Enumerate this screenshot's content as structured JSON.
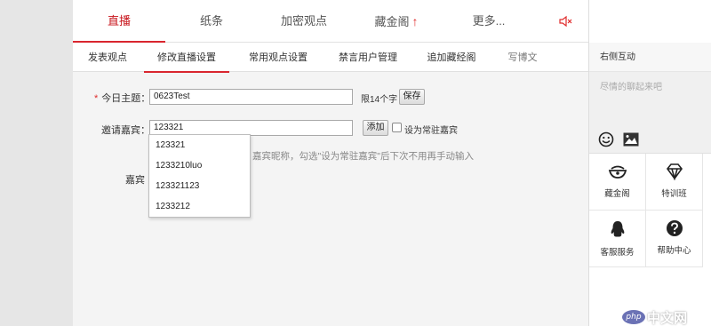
{
  "topnav": {
    "tabs": [
      {
        "label": "直播",
        "active": true
      },
      {
        "label": "纸条"
      },
      {
        "label": "加密观点"
      },
      {
        "label": "藏金阁",
        "hot_arrow": "↑"
      },
      {
        "label": "更多..."
      }
    ],
    "mute_icon": "speaker-mute-icon"
  },
  "subnav": {
    "tabs": [
      {
        "label": "发表观点"
      },
      {
        "label": "修改直播设置",
        "active": true
      },
      {
        "label": "常用观点设置"
      },
      {
        "label": "禁言用户管理"
      },
      {
        "label": "追加藏经阁"
      },
      {
        "label": "写博文"
      }
    ]
  },
  "form": {
    "topic_label": "今日主题：",
    "topic_required_mark": "*",
    "topic_value": "0623Test",
    "topic_hint": "限14个字",
    "save_button": "保存",
    "guest_label": "邀请嘉宾：",
    "guest_value": "123321",
    "add_button": "添加",
    "regular_guest_label": "设为常驻嘉宾",
    "guest_help_text": "嘉宾昵称，勾选\"设为常驻嘉宾\"后下次不用再手动输入",
    "guests_label": "嘉宾",
    "suggestions": [
      "123321",
      "1233210luo",
      "123321123",
      "1233212"
    ]
  },
  "right_panel": {
    "title": "右侧互动",
    "placeholder": "尽情的聊起来吧",
    "icons": [
      "smiley-icon",
      "image-icon"
    ],
    "grid": [
      {
        "label": "藏金阁",
        "icon": "ingot-icon"
      },
      {
        "label": "特训班",
        "icon": "diamond-icon"
      },
      {
        "label": "客服服务",
        "icon": "qq-penguin-icon"
      },
      {
        "label": "帮助中心",
        "icon": "question-icon"
      }
    ]
  },
  "watermark": {
    "badge": "php",
    "text": "中文网"
  },
  "colors": {
    "accent_red": "#d9262e",
    "text_dark": "#333333"
  }
}
